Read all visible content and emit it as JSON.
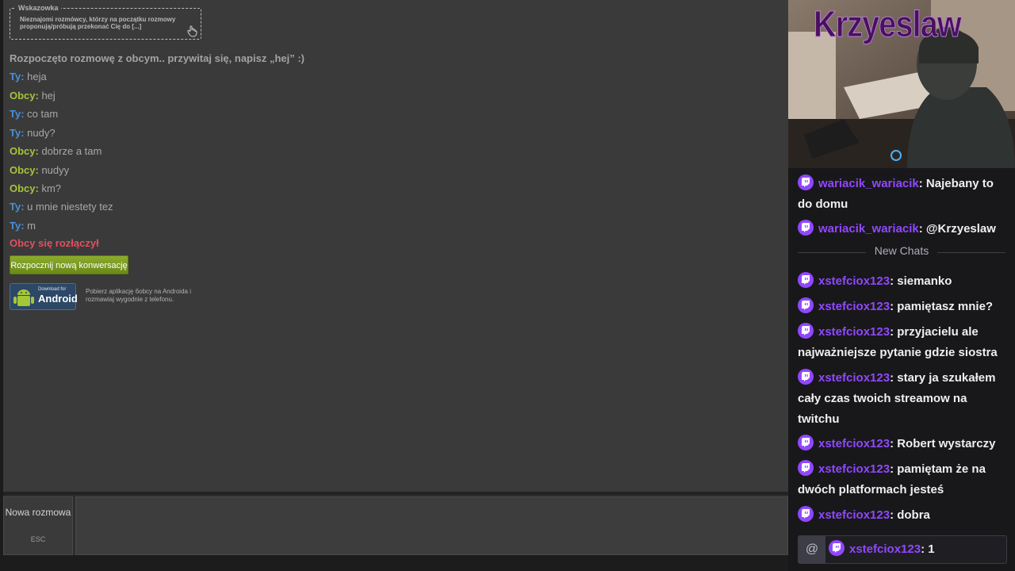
{
  "hint": {
    "legend": "Wskazowka",
    "text": "Nieznajomi rozmówcy, którzy na początku rozmowy proponują/próbują przekonać Cię do [...]"
  },
  "chat": {
    "start_message": "Rozpoczęto rozmowę z obcym.. przywitaj się, napisz „hej” :)",
    "messages": [
      {
        "who": "Ty:",
        "text": " heja"
      },
      {
        "who": "Obcy:",
        "text": " hej"
      },
      {
        "who": "Ty:",
        "text": " co tam"
      },
      {
        "who": "Ty:",
        "text": " nudy?"
      },
      {
        "who": "Obcy:",
        "text": " dobrze a tam"
      },
      {
        "who": "Obcy:",
        "text": " nudyy"
      },
      {
        "who": "Obcy:",
        "text": " km?"
      },
      {
        "who": "Ty:",
        "text": " u mnie niestety tez"
      },
      {
        "who": "Ty:",
        "text": " m"
      }
    ],
    "disconnect_message": "Obcy się rozłączył",
    "new_conversation_button": "Rozpocznij nową konwersację",
    "android_badge_small": "Download for",
    "android_badge_big": "Android",
    "app_promo": "Pobierz aplikację 6obcy na Androida i rozmawiaj wygodnie z telefonu."
  },
  "bottom": {
    "new_chat_label": "Nowa rozmowa",
    "esc_label": "ESC",
    "input_value": ""
  },
  "webcam": {
    "streamer_name": "Krzyeslaw"
  },
  "twitch_chat": {
    "messages_before": [
      {
        "user": "wariacik_wariacik",
        "text": ": Najebany to do domu"
      },
      {
        "user": "wariacik_wariacik",
        "text": ": @Krzyeslaw"
      }
    ],
    "new_chats_label": "New Chats",
    "messages_after": [
      {
        "user": "xstefciox123",
        "text": ": siemanko"
      },
      {
        "user": "xstefciox123",
        "text": ": pamiętasz mnie?"
      },
      {
        "user": "xstefciox123",
        "text": ": przyjacielu ale najważniejsze pytanie gdzie siostra"
      },
      {
        "user": "xstefciox123",
        "text": ": stary ja szukałem cały czas twoich streamow na twitchu"
      },
      {
        "user": "xstefciox123",
        "text": ": Robert wystarczy"
      },
      {
        "user": "xstefciox123",
        "text": ": pamiętam że na dwóch platformach jesteś"
      },
      {
        "user": "xstefciox123",
        "text": ": dobra"
      }
    ],
    "pinned": {
      "user": "xstefciox123",
      "text": ": 1"
    },
    "at_symbol": "@"
  },
  "colors": {
    "ty": "#4a8fd6",
    "obcy": "#a7c33c",
    "disconnect": "#e0515f",
    "twitch_purple": "#9147ff"
  }
}
